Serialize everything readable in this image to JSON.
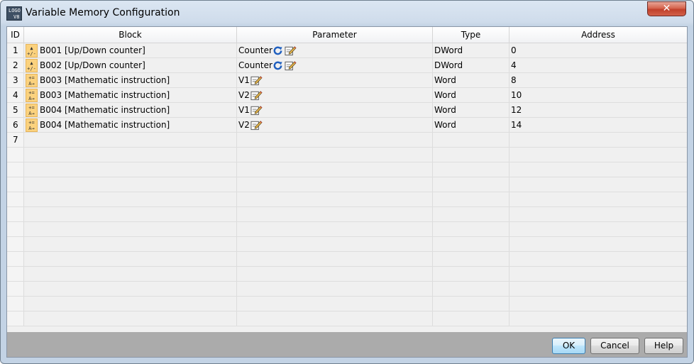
{
  "window": {
    "title": "Variable Memory Configuration",
    "close_label": "✕",
    "app_icon_text": "LOGO V8"
  },
  "columns": {
    "id": "ID",
    "block": "Block",
    "parameter": "Parameter",
    "type": "Type",
    "address": "Address"
  },
  "rows": [
    {
      "id": "1",
      "block_icon": "up-down-counter",
      "icon_lines": [
        "▲",
        "+/-"
      ],
      "block": "B001 [Up/Down counter]",
      "parameter": "Counter",
      "refresh": true,
      "type": "DWord",
      "address": "0"
    },
    {
      "id": "2",
      "block_icon": "up-down-counter",
      "icon_lines": [
        "▲",
        "+/-"
      ],
      "block": "B002 [Up/Down counter]",
      "parameter": "Counter",
      "refresh": true,
      "type": "DWord",
      "address": "4"
    },
    {
      "id": "3",
      "block_icon": "math-instruction",
      "icon_lines": [
        "+=",
        "A→"
      ],
      "block": "B003 [Mathematic instruction]",
      "parameter": "V1",
      "refresh": false,
      "type": "Word",
      "address": "8"
    },
    {
      "id": "4",
      "block_icon": "math-instruction",
      "icon_lines": [
        "+=",
        "A→"
      ],
      "block": "B003 [Mathematic instruction]",
      "parameter": "V2",
      "refresh": false,
      "type": "Word",
      "address": "10"
    },
    {
      "id": "5",
      "block_icon": "math-instruction",
      "icon_lines": [
        "+=",
        "A→"
      ],
      "block": "B004 [Mathematic instruction]",
      "parameter": "V1",
      "refresh": false,
      "type": "Word",
      "address": "12"
    },
    {
      "id": "6",
      "block_icon": "math-instruction",
      "icon_lines": [
        "+=",
        "A→"
      ],
      "block": "B004 [Mathematic instruction]",
      "parameter": "V2",
      "refresh": false,
      "type": "Word",
      "address": "14"
    },
    {
      "id": "7",
      "block_icon": "",
      "icon_lines": [],
      "block": "",
      "parameter": "",
      "refresh": false,
      "type": "",
      "address": ""
    }
  ],
  "buttons": {
    "ok": "OK",
    "cancel": "Cancel",
    "help": "Help"
  },
  "colors": {
    "title_bar": "#c3d3e5",
    "footer": "#ababab",
    "block_icon": "#fbd27e",
    "refresh_icon": "#1f5fbf"
  }
}
